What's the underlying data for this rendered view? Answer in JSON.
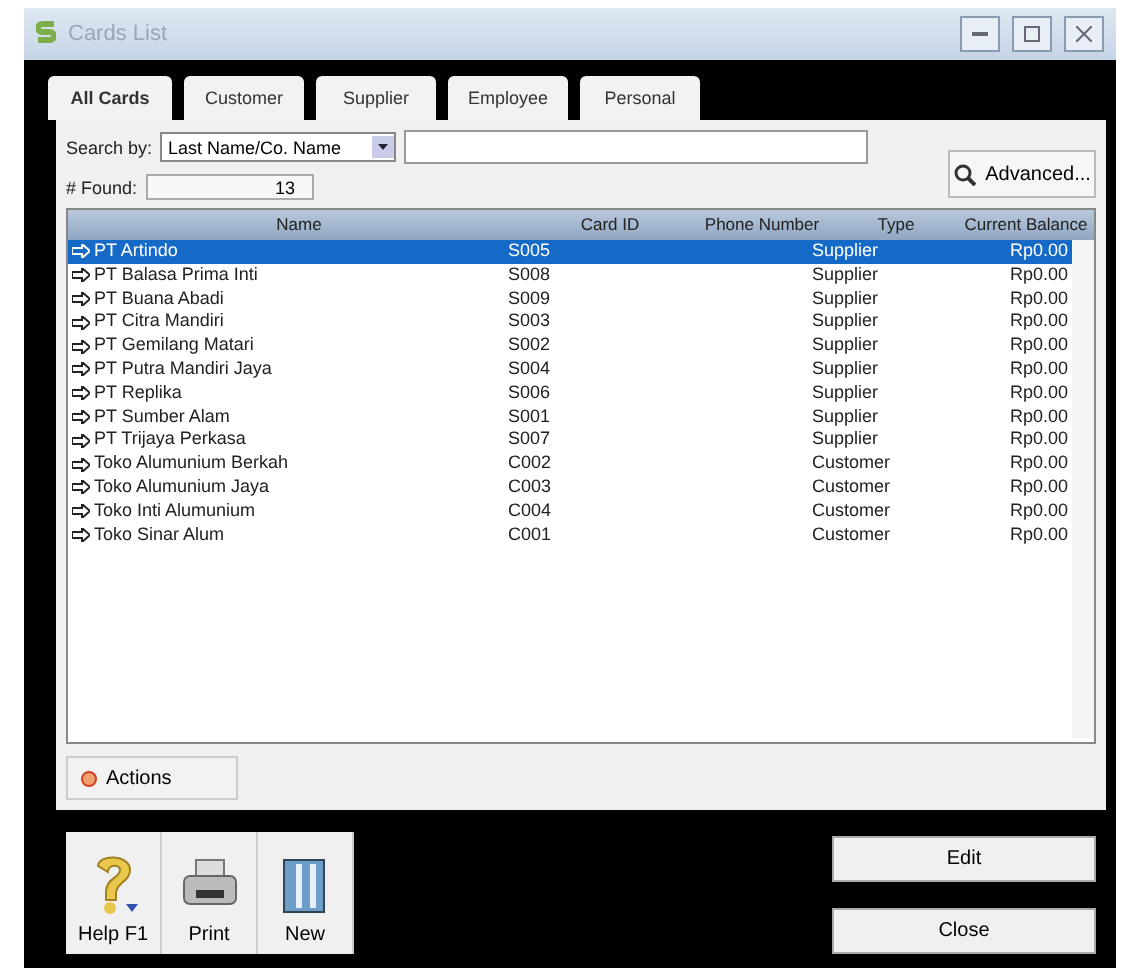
{
  "window": {
    "title": "Cards List"
  },
  "tabs": [
    {
      "label": "All Cards",
      "selected": true
    },
    {
      "label": "Customer",
      "selected": false
    },
    {
      "label": "Supplier",
      "selected": false
    },
    {
      "label": "Employee",
      "selected": false
    },
    {
      "label": "Personal",
      "selected": false
    }
  ],
  "search": {
    "label": "Search by:",
    "field": "Last Name/Co. Name"
  },
  "found": {
    "label": "# Found:",
    "value": "13"
  },
  "advanced_button": "Advanced...",
  "table": {
    "columns": [
      "Name",
      "Card ID",
      "Phone Number",
      "Type",
      "Current Balance"
    ],
    "rows": [
      {
        "name": "PT Artindo",
        "card_id": "S005",
        "type": "Supplier",
        "balance": "Rp0.00",
        "selected": true
      },
      {
        "name": "PT Balasa Prima Inti",
        "card_id": "S008",
        "type": "Supplier",
        "balance": "Rp0.00",
        "selected": false
      },
      {
        "name": "PT Buana Abadi",
        "card_id": "S009",
        "type": "Supplier",
        "balance": "Rp0.00",
        "selected": false
      },
      {
        "name": "PT Citra Mandiri",
        "card_id": "S003",
        "type": "Supplier",
        "balance": "Rp0.00",
        "selected": false
      },
      {
        "name": "PT Gemilang Matari",
        "card_id": "S002",
        "type": "Supplier",
        "balance": "Rp0.00",
        "selected": false
      },
      {
        "name": "PT Putra Mandiri Jaya",
        "card_id": "S004",
        "type": "Supplier",
        "balance": "Rp0.00",
        "selected": false
      },
      {
        "name": "PT Replika",
        "card_id": "S006",
        "type": "Supplier",
        "balance": "Rp0.00",
        "selected": false
      },
      {
        "name": "PT Sumber Alam",
        "card_id": "S001",
        "type": "Supplier",
        "balance": "Rp0.00",
        "selected": false
      },
      {
        "name": "PT Trijaya Perkasa",
        "card_id": "S007",
        "type": "Supplier",
        "balance": "Rp0.00",
        "selected": false
      },
      {
        "name": "Toko Alumunium Berkah",
        "card_id": "C002",
        "type": "Customer",
        "balance": "Rp0.00",
        "selected": false
      },
      {
        "name": "Toko Alumunium Jaya",
        "card_id": "C003",
        "type": "Customer",
        "balance": "Rp0.00",
        "selected": false
      },
      {
        "name": "Toko Inti Alumunium",
        "card_id": "C004",
        "type": "Customer",
        "balance": "Rp0.00",
        "selected": false
      },
      {
        "name": "Toko Sinar Alum",
        "card_id": "C001",
        "type": "Customer",
        "balance": "Rp0.00",
        "selected": false
      }
    ]
  },
  "actions_button": "Actions",
  "toolbar": [
    {
      "kind": "help",
      "label": "Help F1"
    },
    {
      "kind": "print",
      "label": "Print"
    },
    {
      "kind": "new",
      "label": "New"
    }
  ],
  "buttons": [
    "Edit",
    "Close"
  ]
}
